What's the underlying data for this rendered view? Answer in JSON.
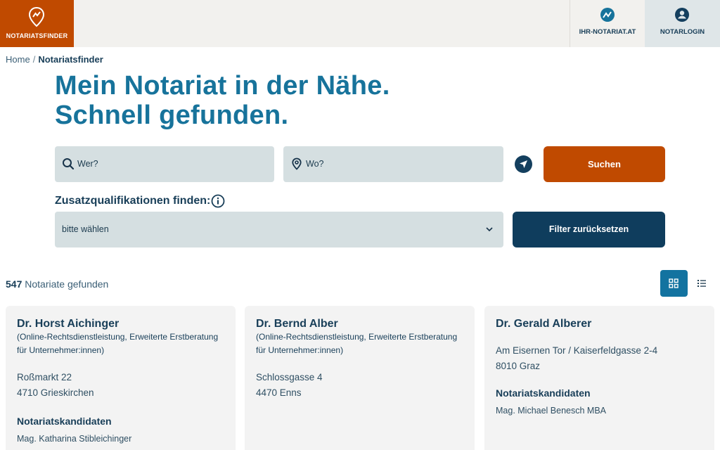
{
  "header": {
    "brand_label": "NOTARIATSFINDER",
    "nav": [
      {
        "label": "IHR-NOTARIAT.AT",
        "icon": "mountain-icon"
      },
      {
        "label": "NOTARLOGIN",
        "icon": "user-icon"
      }
    ]
  },
  "breadcrumb": {
    "home": "Home",
    "separator": "/",
    "current": "Notariatsfinder"
  },
  "title": {
    "line1": "Mein Notariat in der Nähe.",
    "line2": "Schnell gefunden."
  },
  "search": {
    "who_placeholder": "Wer?",
    "where_placeholder": "Wo?",
    "submit_label": "Suchen"
  },
  "filter": {
    "label": "Zusatzqualifikationen finden:",
    "select_value": "bitte wählen",
    "reset_label": "Filter zurücksetzen"
  },
  "results": {
    "count": "547",
    "count_suffix": "Notariate gefunden"
  },
  "cards": [
    {
      "name": "Dr. Horst Aichinger",
      "quals": "(Online-Rechtsdienstleistung, Erweiterte Erstberatung für Unternehmer:innen)",
      "street": "Roßmarkt 22",
      "city": "4710 Grieskirchen",
      "candidates_label": "Notariatskandidaten",
      "candidate": "Mag. Katharina Stibleichinger"
    },
    {
      "name": "Dr. Bernd Alber",
      "quals": "(Online-Rechtsdienstleistung, Erweiterte Erstberatung für Unternehmer:innen)",
      "street": "Schlossgasse 4",
      "city": "4470 Enns"
    },
    {
      "name": "Dr. Gerald Alberer",
      "street": "Am Eisernen Tor / Kaiserfeldgasse 2-4",
      "city": "8010 Graz",
      "candidates_label": "Notariatskandidaten",
      "candidate": "Mag. Michael Benesch MBA"
    }
  ],
  "colors": {
    "brand": "#c04a00",
    "primary": "#17739b",
    "dark": "#0f3d5d",
    "field": "#d5dfe1"
  }
}
